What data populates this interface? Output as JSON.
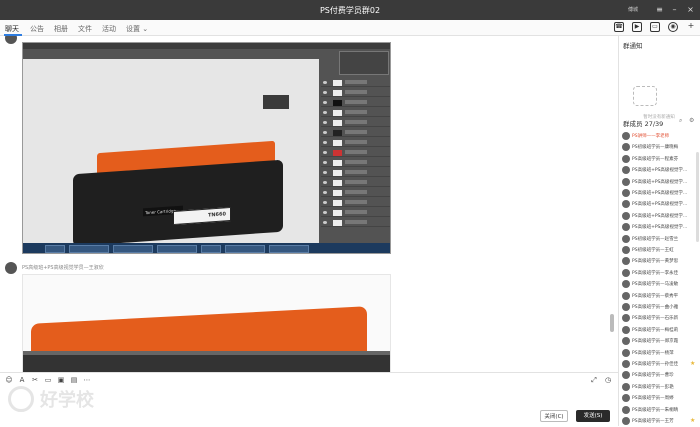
{
  "window": {
    "title": "PS付费学员群02",
    "user": "傅城",
    "colors": {
      "titlebar": "#3a3a3a",
      "accent": "#2e7de1",
      "send_button": "#2a2a2a",
      "host_name": "#e0482a"
    }
  },
  "tabs": [
    {
      "label": "聊天",
      "active": true
    },
    {
      "label": "公告"
    },
    {
      "label": "相册"
    },
    {
      "label": "文件"
    },
    {
      "label": "活动"
    },
    {
      "label": "设置 ⌄"
    }
  ],
  "chat": {
    "messages": [
      {
        "sender": ""
      },
      {
        "sender": "PS高级班+PS高级视觉学员—王淑欣"
      }
    ],
    "toner_label": "TN660",
    "toner_tag": "Toner Cartridge"
  },
  "composer": {
    "tools": [
      "emoji-icon",
      "font-icon",
      "scissors-icon",
      "folder-icon",
      "image-icon",
      "gallery-icon",
      "more-icon"
    ],
    "close_label": "关闭(C)",
    "send_label": "发送(S)"
  },
  "sidebar": {
    "announcement_title": "群通知",
    "announcement_empty": "暂时没有新通知",
    "members_title": "群成员 27/39",
    "members": [
      {
        "name": "PS讲师——李老师",
        "host": true
      },
      {
        "name": "PS初级班学员—康晓梅"
      },
      {
        "name": "PS高级班学员—程素芬"
      },
      {
        "name": "PS高级班+PS高级视觉学..."
      },
      {
        "name": "PS高级班+PS高级视觉学..."
      },
      {
        "name": "PS高级班+PS高级视觉学..."
      },
      {
        "name": "PS高级班+PS高级视觉学..."
      },
      {
        "name": "PS高级班+PS高级视觉学..."
      },
      {
        "name": "PS高级班+PS高级视觉学..."
      },
      {
        "name": "PS初级班学员—赵雪兰"
      },
      {
        "name": "PS初级班学员—王虹"
      },
      {
        "name": "PS高级班学员—黄梦思"
      },
      {
        "name": "PS高级班学员—李永佳"
      },
      {
        "name": "PS高级班学员—马凌敏"
      },
      {
        "name": "PS高级班学员—蔡秀平"
      },
      {
        "name": "PS高级班学员—曲小雅"
      },
      {
        "name": "PS高级班学员—石乐新"
      },
      {
        "name": "PS高级班学员—梅桂莉"
      },
      {
        "name": "PS高级班学员—郑京霞"
      },
      {
        "name": "PS高级班学员—杨萍"
      },
      {
        "name": "PS高级班学员—孙佳佳",
        "star": true
      },
      {
        "name": "PS高级班学员—曹珍"
      },
      {
        "name": "PS高级班学员—彭艳"
      },
      {
        "name": "PS高级班学员—周婷"
      },
      {
        "name": "PS高级班学员—朱桐晴"
      },
      {
        "name": "PS高级班学员—王芳",
        "star": true
      }
    ]
  }
}
